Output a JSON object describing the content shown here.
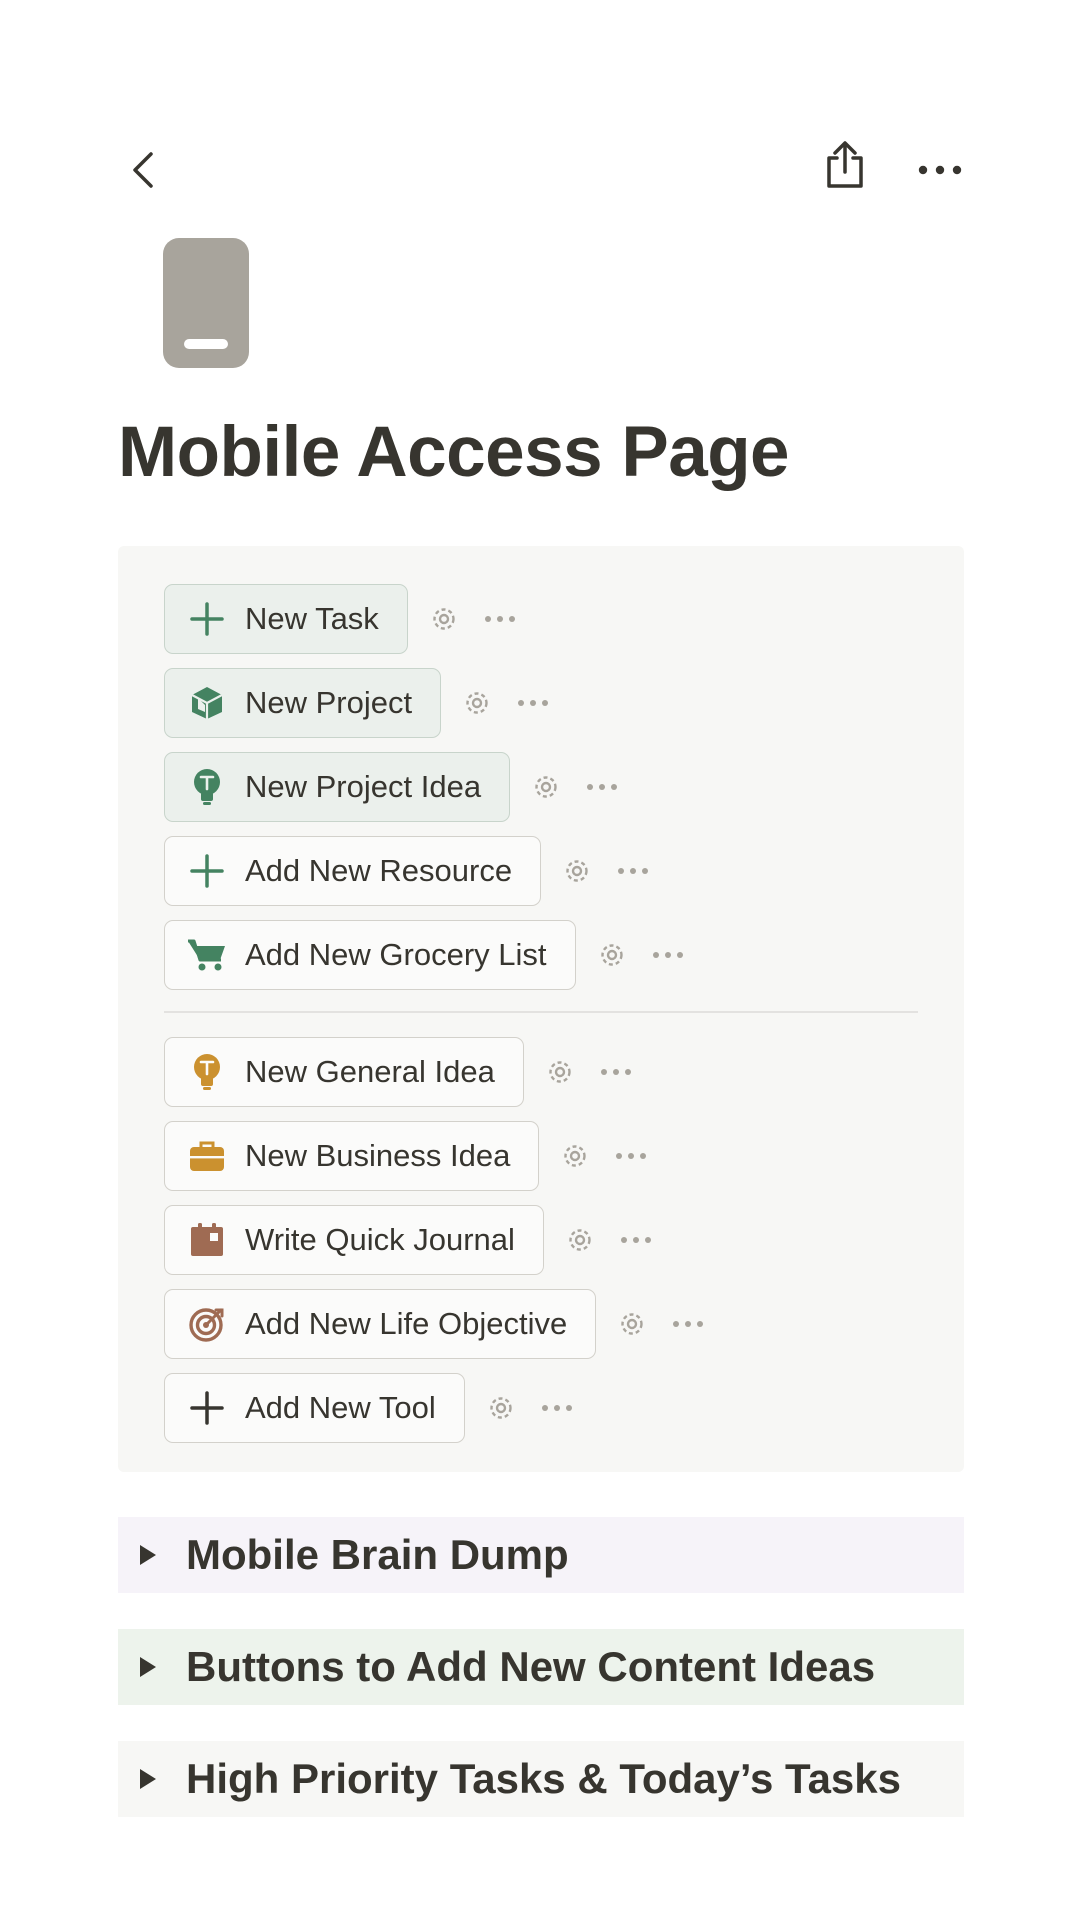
{
  "header": {
    "back_icon": "chevron-left-icon",
    "share_icon": "share-icon",
    "more_icon": "more-horizontal-icon"
  },
  "page": {
    "icon": "mobile-phone-icon",
    "title": "Mobile Access Page"
  },
  "buttons_group_1": [
    {
      "label": "New Task",
      "icon": "plus-icon"
    },
    {
      "label": "New Project",
      "icon": "cube-icon"
    },
    {
      "label": "New Project Idea",
      "icon": "lightbulb-icon"
    },
    {
      "label": "Add New Resource",
      "icon": "plus-icon"
    },
    {
      "label": "Add New Grocery List",
      "icon": "shopping-cart-icon"
    }
  ],
  "buttons_group_2": [
    {
      "label": "New General Idea",
      "icon": "lightbulb-icon"
    },
    {
      "label": "New Business Idea",
      "icon": "briefcase-icon"
    },
    {
      "label": "Write Quick Journal",
      "icon": "calendar-icon"
    },
    {
      "label": "Add New Life Objective",
      "icon": "target-icon"
    },
    {
      "label": "Add New Tool",
      "icon": "plus-icon"
    }
  ],
  "toggles": [
    {
      "label": "Mobile Brain Dump",
      "bg": "#f6f3f9"
    },
    {
      "label": "Buttons to Add New Content Ideas",
      "bg": "#edf3ec"
    },
    {
      "label": "High Priority Tasks & Today’s Tasks",
      "bg": "#f7f7f5"
    }
  ],
  "colors": {
    "text": "#37352f",
    "green_icon": "#448361",
    "yellow_icon": "#cb912f",
    "brown_icon": "#9f6b53",
    "gray_icon": "#a8a49c"
  }
}
